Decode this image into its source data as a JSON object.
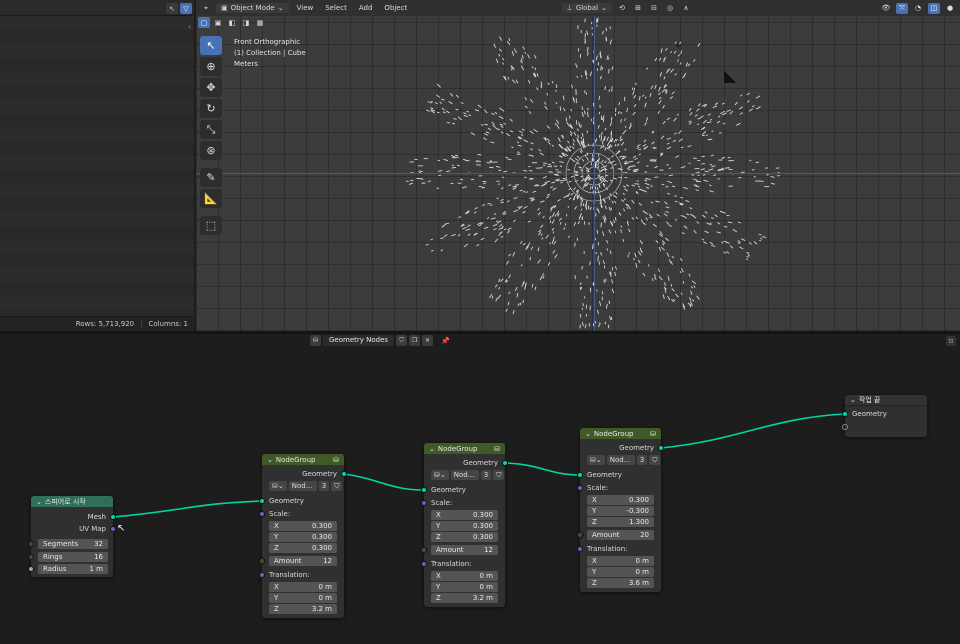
{
  "spreadsheet": {
    "rows_label": "Rows: 5,713,920",
    "columns_label": "Columns: 1"
  },
  "viewport": {
    "mode": "Object Mode",
    "menus": [
      "View",
      "Select",
      "Add",
      "Object"
    ],
    "orientation": "Global",
    "info_view": "Front Orthographic",
    "info_collection": "(1) Collection | Cube",
    "info_units": "Meters"
  },
  "node_editor": {
    "tree_name": "Geometry Nodes",
    "nodes": {
      "sphere": {
        "title": "스피어로 시작",
        "out_mesh": "Mesh",
        "out_uv": "UV Map",
        "segments_label": "Segments",
        "segments": "32",
        "rings_label": "Rings",
        "rings": "16",
        "radius_label": "Radius",
        "radius": "1 m"
      },
      "ng1": {
        "title": "NodeGroup",
        "sel": "Nod...",
        "users": "3",
        "out_geometry": "Geometry",
        "in_geometry": "Geometry",
        "scale_label": "Scale:",
        "sx": "0.300",
        "sy": "0.300",
        "sz": "0.300",
        "amount_label": "Amount",
        "amount": "12",
        "translation_label": "Translation:",
        "tx": "0 m",
        "ty": "0 m",
        "tz": "3.2 m"
      },
      "ng2": {
        "title": "NodeGroup",
        "sel": "Nod...",
        "users": "3",
        "out_geometry": "Geometry",
        "in_geometry": "Geometry",
        "scale_label": "Scale:",
        "sx": "0.300",
        "sy": "0.300",
        "sz": "0.300",
        "amount_label": "Amount",
        "amount": "12",
        "translation_label": "Translation:",
        "tx": "0 m",
        "ty": "0 m",
        "tz": "3.2 m"
      },
      "ng3": {
        "title": "NodeGroup",
        "sel": "Nod...",
        "users": "3",
        "out_geometry": "Geometry",
        "in_geometry": "Geometry",
        "scale_label": "Scale:",
        "sx": "0.300",
        "sy": "-0.300",
        "sz": "1.300",
        "amount_label": "Amount",
        "amount": "20",
        "translation_label": "Translation:",
        "tx": "0 m",
        "ty": "0 m",
        "tz": "3.6 m"
      },
      "output": {
        "title": "작업 끝",
        "in_geometry": "Geometry"
      }
    }
  },
  "colors": {
    "geometry_socket": "#00d6a3",
    "vector_socket": "#6363c7",
    "nodegroup_header": "#3f5a26",
    "input_header": "#2f6e5a",
    "active_tool": "#4772b3",
    "x_axis": "#9b3a3a",
    "z_axis": "#3d5d96"
  },
  "axis_labels": {
    "x": "X",
    "y": "Y",
    "z": "Z"
  }
}
